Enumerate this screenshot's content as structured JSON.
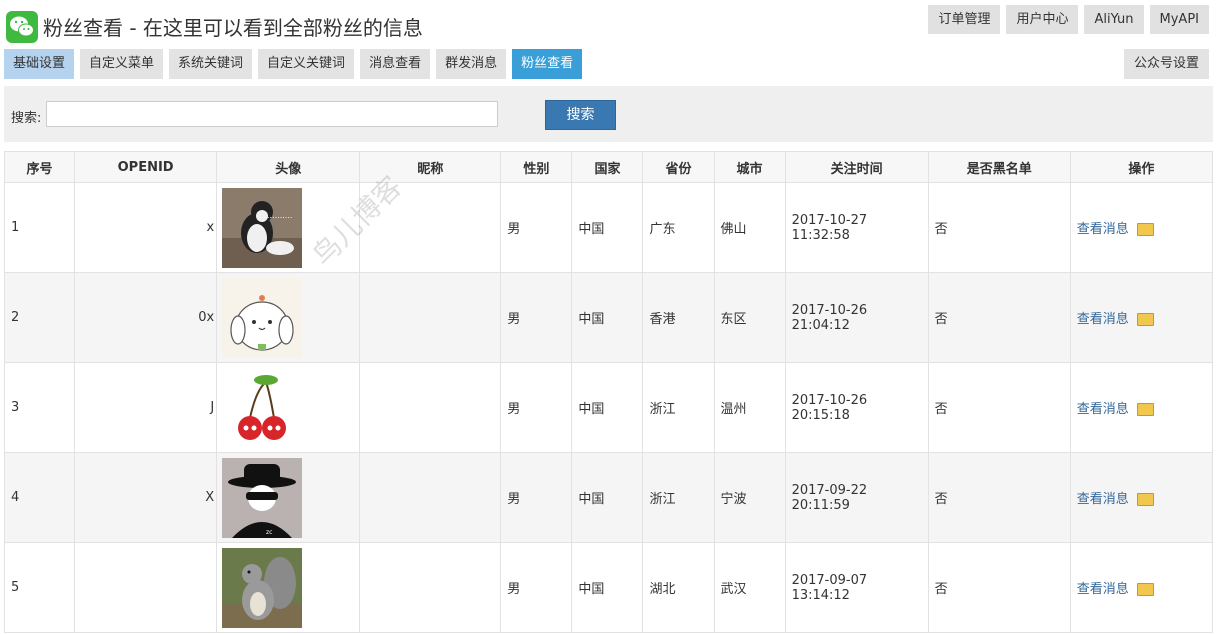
{
  "header": {
    "title": "粉丝查看 - 在这里可以看到全部粉丝的信息",
    "top_buttons": [
      "订单管理",
      "用户中心",
      "AliYun",
      "MyAPI"
    ]
  },
  "nav": {
    "items": [
      "基础设置",
      "自定义菜单",
      "系统关键词",
      "自定义关键词",
      "消息查看",
      "群发消息",
      "粉丝查看"
    ],
    "settings_label": "公众号设置"
  },
  "search": {
    "label": "搜索:",
    "value": "",
    "button_label": "搜索"
  },
  "table": {
    "headers": [
      "序号",
      "OPENID",
      "头像",
      "昵称",
      "性别",
      "国家",
      "省份",
      "城市",
      "关注时间",
      "是否黑名单",
      "操作"
    ],
    "rows": [
      {
        "id": "1",
        "openid_fragment": "x",
        "nickname": "",
        "gender": "男",
        "country": "中国",
        "province": "广东",
        "city": "佛山",
        "follow_time": "2017-10-27 11:32:58",
        "blacklist": "否",
        "action": "查看消息"
      },
      {
        "id": "2",
        "openid_fragment": "0x",
        "nickname": "",
        "gender": "男",
        "country": "中国",
        "province": "香港",
        "city": "东区",
        "follow_time": "2017-10-26 21:04:12",
        "blacklist": "否",
        "action": "查看消息"
      },
      {
        "id": "3",
        "openid_fragment": "J",
        "nickname": "",
        "gender": "男",
        "country": "中国",
        "province": "浙江",
        "city": "温州",
        "follow_time": "2017-10-26 20:15:18",
        "blacklist": "否",
        "action": "查看消息"
      },
      {
        "id": "4",
        "openid_fragment": "X",
        "nickname": "",
        "gender": "男",
        "country": "中国",
        "province": "浙江",
        "city": "宁波",
        "follow_time": "2017-09-22 20:11:59",
        "blacklist": "否",
        "action": "查看消息"
      },
      {
        "id": "5",
        "openid_fragment": "",
        "nickname": "",
        "gender": "男",
        "country": "中国",
        "province": "湖北",
        "city": "武汉",
        "follow_time": "2017-09-07 13:14:12",
        "blacklist": "否",
        "action": "查看消息"
      }
    ]
  },
  "watermark": "鸟儿博客",
  "colors": {
    "active_tab": "#3a9fd8",
    "primary_tab": "#b5d2ee",
    "search_button": "#3a78b2",
    "link": "#336699"
  },
  "icons": {
    "logo": "wechat-icon",
    "action": "folder-icon"
  }
}
